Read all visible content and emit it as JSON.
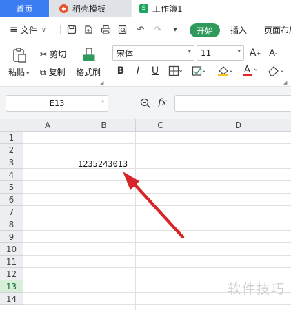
{
  "tabs": {
    "home": "首页",
    "template": "稻壳模板",
    "document": "工作簿1"
  },
  "menu": {
    "file": "文件",
    "start": "开始",
    "insert": "插入",
    "page_layout": "页面布局"
  },
  "ribbon": {
    "paste": "粘贴",
    "cut": "剪切",
    "copy": "复制",
    "format_painter": "格式刷",
    "font_name": "宋体",
    "font_size": "11"
  },
  "formula_bar": {
    "cell_ref": "E13",
    "fx": "fx",
    "value": ""
  },
  "grid": {
    "columns": [
      "A",
      "B",
      "C",
      "D"
    ],
    "rows": [
      "1",
      "2",
      "3",
      "4",
      "5",
      "6",
      "7",
      "8",
      "9",
      "10",
      "11",
      "12",
      "13",
      "14"
    ],
    "active_row": "13",
    "cell_b3": "1235243013"
  },
  "watermark": "软件技巧",
  "colors": {
    "accent": "#2f9a5c",
    "home_tab": "#3c7cf2",
    "arrow": "#e0262a"
  }
}
